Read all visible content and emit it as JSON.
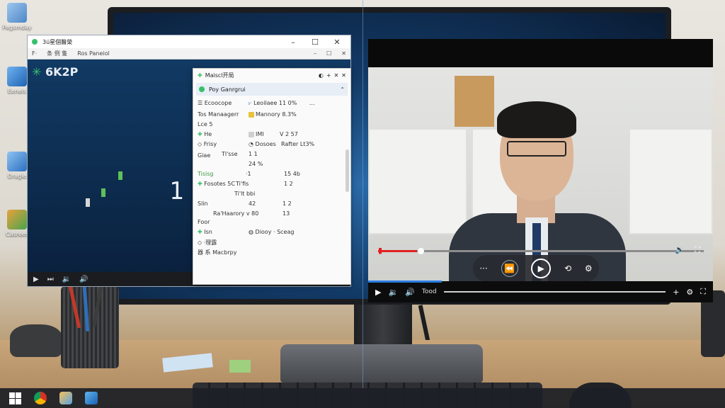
{
  "desktop": {
    "icons": [
      {
        "label": "Pegsmday"
      },
      {
        "label": "Eeneis"
      },
      {
        "label": "Oragle"
      },
      {
        "label": "Casrees"
      }
    ]
  },
  "left_window": {
    "title": "3ü星個醫榮",
    "menu": [
      "F·",
      "条 例 隻",
      "Ros Paneiol"
    ],
    "logo_text": "6K2P",
    "big_text": "1 >f",
    "controls": [
      "▶",
      "⏭",
      "🔉",
      "🔊"
    ]
  },
  "task_manager": {
    "title": "Maiscl开局",
    "header": "Poy Ganrgrui",
    "rows": [
      "Ecoocope",
      "Tos Manaagerr",
      "Lce 5",
      "He",
      "Frisy",
      "Giae",
      "Tisisg",
      "Fosotes 5C",
      "Slin",
      "Foor",
      "Isn",
      "·理露",
      "器 系 Macbrpy"
    ],
    "col2": [
      "Leoilaee 11 0%",
      "Mannory 8.3%",
      "IMI",
      "Dosoes",
      "Tl'sse",
      "24 %",
      "·1",
      "Ti'lt bbi",
      "Ti'fis",
      "42",
      "Ra'Haarory v 80",
      "Diooy · Sceag"
    ],
    "col3": [
      "...",
      "V 2 57",
      "Rafter Lt3%",
      "1 1",
      "15 4b",
      "1 2",
      "1 2",
      "13"
    ]
  },
  "video_player": {
    "time_label": "Tood",
    "pill_buttons": [
      "···",
      "⟲",
      "⚙"
    ]
  },
  "colors": {
    "accent": "#2b7de0",
    "seek_red": "#e02020",
    "tm_green": "#37c06b"
  },
  "progress": {
    "video_seek": 0.12
  }
}
